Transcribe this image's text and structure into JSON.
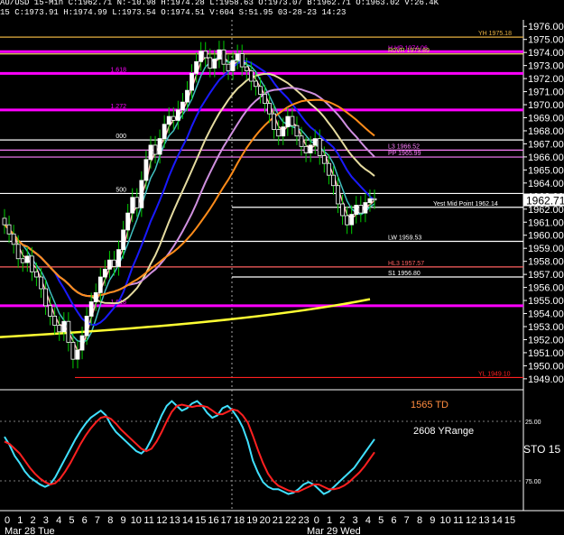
{
  "header": {
    "line1": "AU/USD 15-Min C:1962.71 N:-10.98 H:1974.28 L:1958.63 O:1973.07 B:1962.71 O:1963.02 V:26.4K",
    "line2": "15 C:1973.91 H:1974.99 L:1973.54 O:1974.51 V:604 S:51.95 03-28-23 14:23"
  },
  "colors": {
    "background": "#000000",
    "price_candle_up": "#ffffff",
    "price_candle_down": "#ffffff",
    "wick": "#00cc00",
    "magenta": "#ff00ff",
    "white": "#ffffff",
    "orange": "#ff8c1a",
    "yellow": "#ffff33",
    "blue": "#1a1aff",
    "cyan": "#40c0c0",
    "pink": "#ffb0b0",
    "khaki": "#e6dca0",
    "lavender": "#d090e0",
    "stoch_fast": "#40e0ff",
    "stoch_slow": "#ff2020",
    "grid": "#7d7d7d"
  },
  "chart_data": [
    {
      "type": "candlestick",
      "ylim": [
        1948.3,
        1976.5
      ],
      "yticks": [
        "1976.00",
        "1975.00",
        "1974.00",
        "1973.00",
        "1972.00",
        "1971.00",
        "1970.00",
        "1969.00",
        "1968.00",
        "1967.00",
        "1966.00",
        "1965.00",
        "1964.00",
        "1963.00",
        "1962.00",
        "1961.00",
        "1960.00",
        "1959.00",
        "1958.00",
        "1957.00",
        "1956.00",
        "1955.00",
        "1954.00",
        "1953.00",
        "1952.00",
        "1951.00",
        "1950.00",
        "1949.00"
      ],
      "last_price": "1962.71",
      "close": [
        1960.8,
        1960.1,
        1959.3,
        1958.2,
        1957.9,
        1958.4,
        1957.2,
        1956.8,
        1955.9,
        1954.6,
        1953.8,
        1953.1,
        1952.6,
        1953.4,
        1951.8,
        1950.5,
        1951.2,
        1952.3,
        1953.8,
        1954.9,
        1955.6,
        1956.8,
        1957.4,
        1958.1,
        1957.6,
        1958.9,
        1960.4,
        1961.7,
        1962.9,
        1962.1,
        1964.2,
        1965.8,
        1966.9,
        1966.2,
        1967.4,
        1968.5,
        1969.1,
        1968.8,
        1969.6,
        1970.2,
        1971.1,
        1972.4,
        1973.3,
        1974.1,
        1973.6,
        1972.8,
        1973.5,
        1974.2,
        1973.1,
        1972.6,
        1973.4,
        1973.9,
        1972.9,
        1972.6,
        1971.8,
        1971.4,
        1970.8,
        1970.1,
        1969.3,
        1968.1,
        1967.6,
        1968.3,
        1969.1,
        1968.4,
        1967.6,
        1966.8,
        1966.3,
        1966.9,
        1967.4,
        1966.1,
        1965.5,
        1964.6,
        1963.8,
        1962.4,
        1961.5,
        1960.8,
        1961.6,
        1962.3,
        1961.7,
        1962.5,
        1962.8,
        1962.7
      ],
      "high_offset": 0.7,
      "low_offset": 0.7,
      "levels": [
        {
          "label": "YH 1975.18",
          "value": 1975.18,
          "color": "#e6b040"
        },
        {
          "label": "H HP 1974.06",
          "value": 1974.06,
          "color": "#ff00ff"
        },
        {
          "label": "R0VR 1973.89",
          "value": 1973.89,
          "color": "#e6dc60"
        },
        {
          "label": "1.618",
          "value": 1972.4,
          "color": "#ff00ff"
        },
        {
          "label": "1.272",
          "value": 1969.6,
          "color": "#ff00ff"
        },
        {
          "label": "000",
          "value": 1967.3,
          "color": "#ffffff"
        },
        {
          "label": "L3 1966.52",
          "value": 1966.52,
          "color": "#ff80ff"
        },
        {
          "label": "PP 1965.99",
          "value": 1965.99,
          "color": "#ff80ff"
        },
        {
          "label": "500",
          "value": 1963.2,
          "color": "#ffffff"
        },
        {
          "label": "Yest Mid Point 1962.14",
          "value": 1962.14,
          "color": "#ffffff"
        },
        {
          "label": "LW 1959.53",
          "value": 1959.53,
          "color": "#ffffff"
        },
        {
          "label": "HL3 1957.57",
          "value": 1957.57,
          "color": "#ff6060"
        },
        {
          "label": "S1 1956.80",
          "value": 1956.8,
          "color": "#ffffff"
        },
        {
          "label": "1.618",
          "value": 1954.6,
          "color": "#ff00ff"
        },
        {
          "label": "YL 1949.10",
          "value": 1949.1,
          "color": "#ff2020"
        }
      ]
    },
    {
      "type": "line",
      "name": "stochastic",
      "ylim": [
        0,
        100
      ],
      "labels": {
        "td": "1565 TD",
        "yrange": "2608 YRange",
        "sto": "STO 15"
      },
      "yticks": [
        "25.00",
        "75.00"
      ],
      "fast": [
        62,
        55,
        46,
        40,
        33,
        28,
        25,
        22,
        20,
        22,
        28,
        36,
        44,
        52,
        60,
        67,
        73,
        78,
        81,
        84,
        80,
        72,
        66,
        62,
        58,
        54,
        50,
        48,
        52,
        60,
        70,
        80,
        88,
        92,
        88,
        84,
        86,
        90,
        92,
        88,
        82,
        78,
        80,
        86,
        88,
        84,
        78,
        70,
        58,
        42,
        32,
        24,
        20,
        18,
        18,
        16,
        14,
        15,
        18,
        22,
        24,
        22,
        18,
        14,
        16,
        20,
        24,
        28,
        32,
        36,
        42,
        48,
        54,
        60
      ],
      "slow": [
        58,
        56,
        52,
        48,
        42,
        36,
        31,
        27,
        24,
        22,
        23,
        27,
        33,
        40,
        48,
        56,
        63,
        69,
        74,
        78,
        79,
        77,
        73,
        68,
        64,
        60,
        56,
        52,
        50,
        52,
        58,
        66,
        75,
        83,
        88,
        89,
        88,
        87,
        88,
        88,
        87,
        84,
        81,
        81,
        83,
        85,
        84,
        80,
        74,
        63,
        51,
        40,
        31,
        25,
        21,
        19,
        17,
        16,
        16,
        18,
        20,
        22,
        22,
        20,
        18,
        18,
        19,
        21,
        24,
        28,
        32,
        37,
        43,
        49
      ]
    }
  ],
  "xaxis": {
    "hours": [
      "0",
      "1",
      "2",
      "3",
      "4",
      "5",
      "6",
      "7",
      "8",
      "9",
      "10",
      "11",
      "12",
      "13",
      "14",
      "15",
      "16",
      "17",
      "18",
      "19",
      "20",
      "21",
      "22",
      "23",
      "0",
      "1",
      "2",
      "3",
      "4",
      "5",
      "6",
      "7",
      "8",
      "9",
      "10",
      "11",
      "12",
      "13",
      "14",
      "15"
    ],
    "dates": [
      "Mar 28 Tue",
      "Mar 29 Wed"
    ]
  }
}
